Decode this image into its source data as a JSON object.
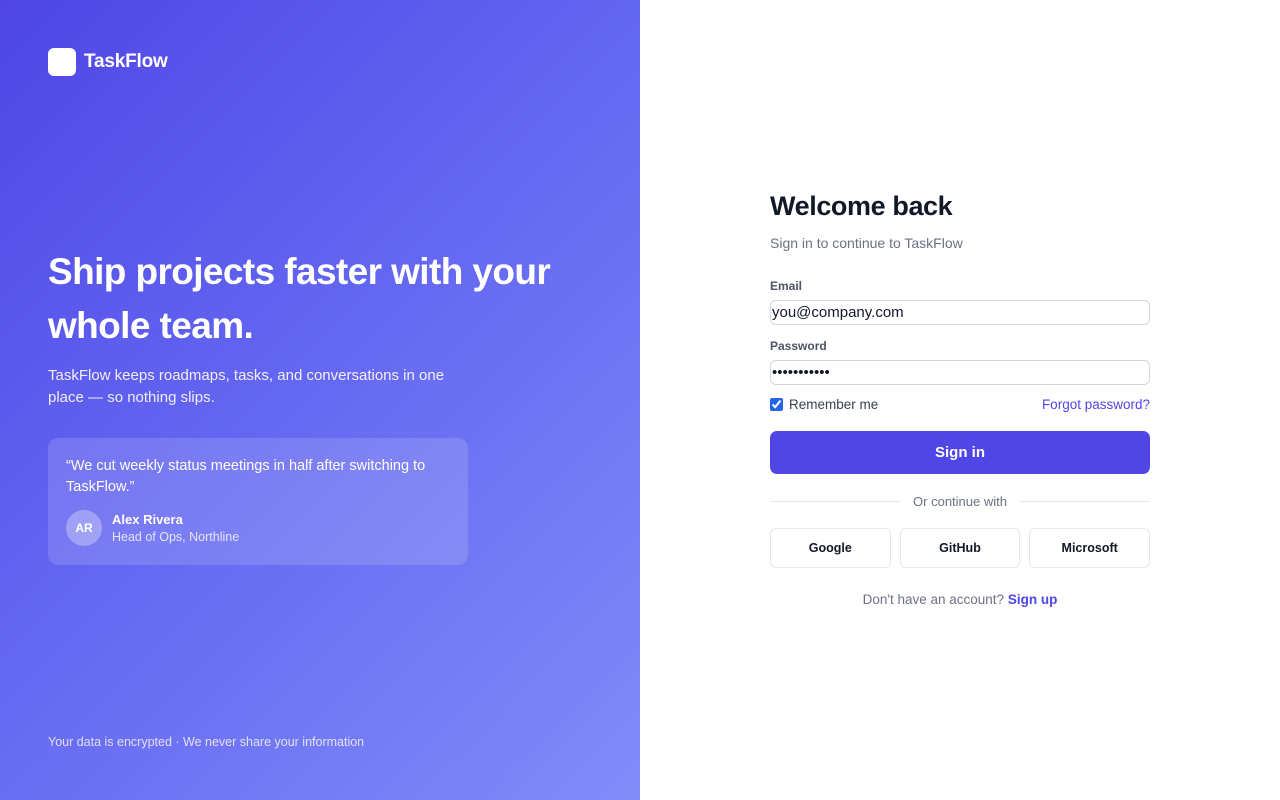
{
  "brand": {
    "name": "TaskFlow"
  },
  "hero": {
    "headline": "Ship projects faster with your whole team.",
    "subhead": "TaskFlow keeps roadmaps, tasks, and conversations in one place — so nothing slips.",
    "testimonial": {
      "quote": "“We cut weekly status meetings in half after switching to TaskFlow.”",
      "initials": "AR",
      "name": "Alex Rivera",
      "role": "Head of Ops, Northline"
    },
    "footer": "Your data is encrypted · We never share your information"
  },
  "form": {
    "title": "Welcome back",
    "subtitle": "Sign in to continue to TaskFlow",
    "email": {
      "label": "Email",
      "value": "you@company.com"
    },
    "password": {
      "label": "Password",
      "value": "•••••••••••"
    },
    "remember": {
      "label": "Remember me",
      "checked": true
    },
    "forgot_label": "Forgot password?",
    "submit_label": "Sign in",
    "divider_label": "Or continue with",
    "providers": [
      "Google",
      "GitHub",
      "Microsoft"
    ],
    "signup_prompt": "Don't have an account?",
    "signup_label": "Sign up"
  },
  "colors": {
    "accent": "#4f46e5",
    "gradient_start": "#4f46e5",
    "gradient_end": "#818cf8"
  }
}
